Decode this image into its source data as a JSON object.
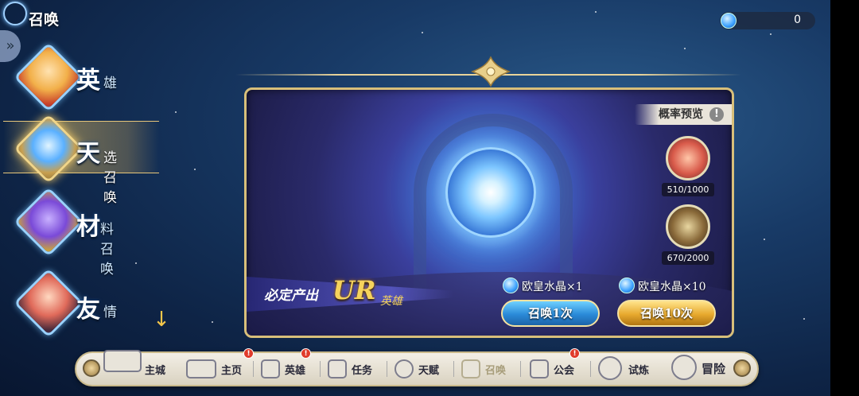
{
  "header": {
    "title": "召唤"
  },
  "currency": {
    "value": "0",
    "icon": "blue-gem-icon"
  },
  "side_menu": [
    {
      "big": "英",
      "small": "雄",
      "active": false
    },
    {
      "big": "天",
      "small": "选召唤",
      "active": true
    },
    {
      "big": "材",
      "small": "料召唤",
      "active": false
    },
    {
      "big": "友",
      "small": "情",
      "active": false
    }
  ],
  "panel": {
    "probability_label": "概率预览",
    "info_glyph": "!",
    "banner": {
      "prefix": "必定产出",
      "rarity": "UR",
      "suffix": "英雄"
    },
    "rewards": [
      {
        "count": "510/1000",
        "icon": "treasure-chest-icon"
      },
      {
        "count": "670/2000",
        "icon": "golden-chest-icon"
      }
    ],
    "summon_single": {
      "cost": "欧皇水晶×1",
      "label": "召唤1次"
    },
    "summon_ten": {
      "cost": "欧皇水晶×10",
      "label": "召唤10次"
    }
  },
  "bottom_nav": [
    {
      "label": "主城",
      "badge": ""
    },
    {
      "label": "主页",
      "badge": "!"
    },
    {
      "label": "英雄",
      "badge": "!"
    },
    {
      "label": "任务",
      "badge": ""
    },
    {
      "label": "天赋",
      "badge": ""
    },
    {
      "label": "召唤",
      "badge": ""
    },
    {
      "label": "公会",
      "badge": "!"
    },
    {
      "label": "试炼",
      "badge": ""
    },
    {
      "label": "冒险",
      "badge": ""
    }
  ],
  "colors": {
    "accent_gold": "#d8bf7a",
    "badge_red": "#e03b2b",
    "active_glow": "#e8c77a"
  }
}
